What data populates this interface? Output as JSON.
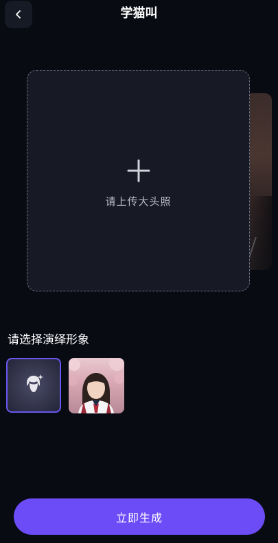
{
  "header": {
    "title": "学猫叫",
    "back_icon": "chevron-left-icon"
  },
  "upload": {
    "hint": "请上传大头照",
    "icon": "plus-icon"
  },
  "avatars": {
    "section_title": "请选择演绎形象",
    "items": [
      {
        "type": "custom",
        "icon": "face-sparkle-icon",
        "selected": true
      },
      {
        "type": "photo",
        "description": "girl-in-school-uniform",
        "selected": false
      }
    ]
  },
  "actions": {
    "generate_label": "立即生成"
  },
  "colors": {
    "background": "#090b13",
    "accent": "#6b4cf6",
    "card": "#171a25"
  }
}
